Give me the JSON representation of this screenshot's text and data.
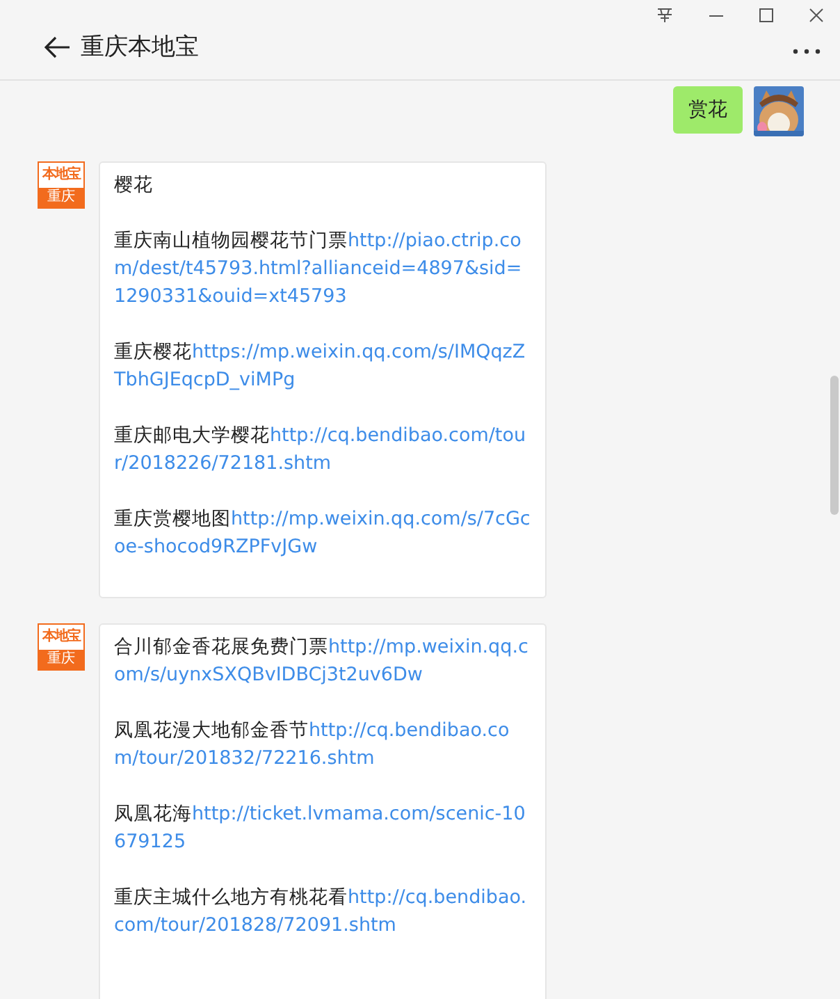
{
  "window": {
    "title": "重庆本地宝"
  },
  "messages": [
    {
      "kind": "outgoing",
      "text": "赏花"
    },
    {
      "kind": "incoming",
      "logo": {
        "top": "本地宝",
        "bottom": "重庆"
      },
      "paragraphs": [
        {
          "text": "樱花"
        },
        {
          "text": "重庆南山植物园樱花节门票",
          "link": "http://piao.ctrip.com/dest/t45793.html?allianceid=4897&sid=1290331&ouid=xt45793"
        },
        {
          "text": "重庆樱花",
          "link": "https://mp.weixin.qq.com/s/IMQqzZTbhGJEqcpD_viMPg"
        },
        {
          "text": "重庆邮电大学樱花",
          "link": "http://cq.bendibao.com/tour/2018226/72181.shtm"
        },
        {
          "text": "重庆赏樱地图",
          "link": "http://mp.weixin.qq.com/s/7cGcoe-shocod9RZPFvJGw"
        }
      ]
    },
    {
      "kind": "incoming",
      "logo": {
        "top": "本地宝",
        "bottom": "重庆"
      },
      "paragraphs": [
        {
          "text": "合川郁金香花展免费门票",
          "link": "http://mp.weixin.qq.com/s/uynxSXQBvIDBCj3t2uv6Dw"
        },
        {
          "text": "凤凰花漫大地郁金香节",
          "link": "http://cq.bendibao.com/tour/201832/72216.shtm"
        },
        {
          "text": "凤凰花海",
          "link": "http://ticket.lvmama.com/scenic-10679125"
        },
        {
          "text": "重庆主城什么地方有桃花看",
          "link": "http://cq.bendibao.com/tour/201828/72091.shtm"
        }
      ]
    }
  ]
}
